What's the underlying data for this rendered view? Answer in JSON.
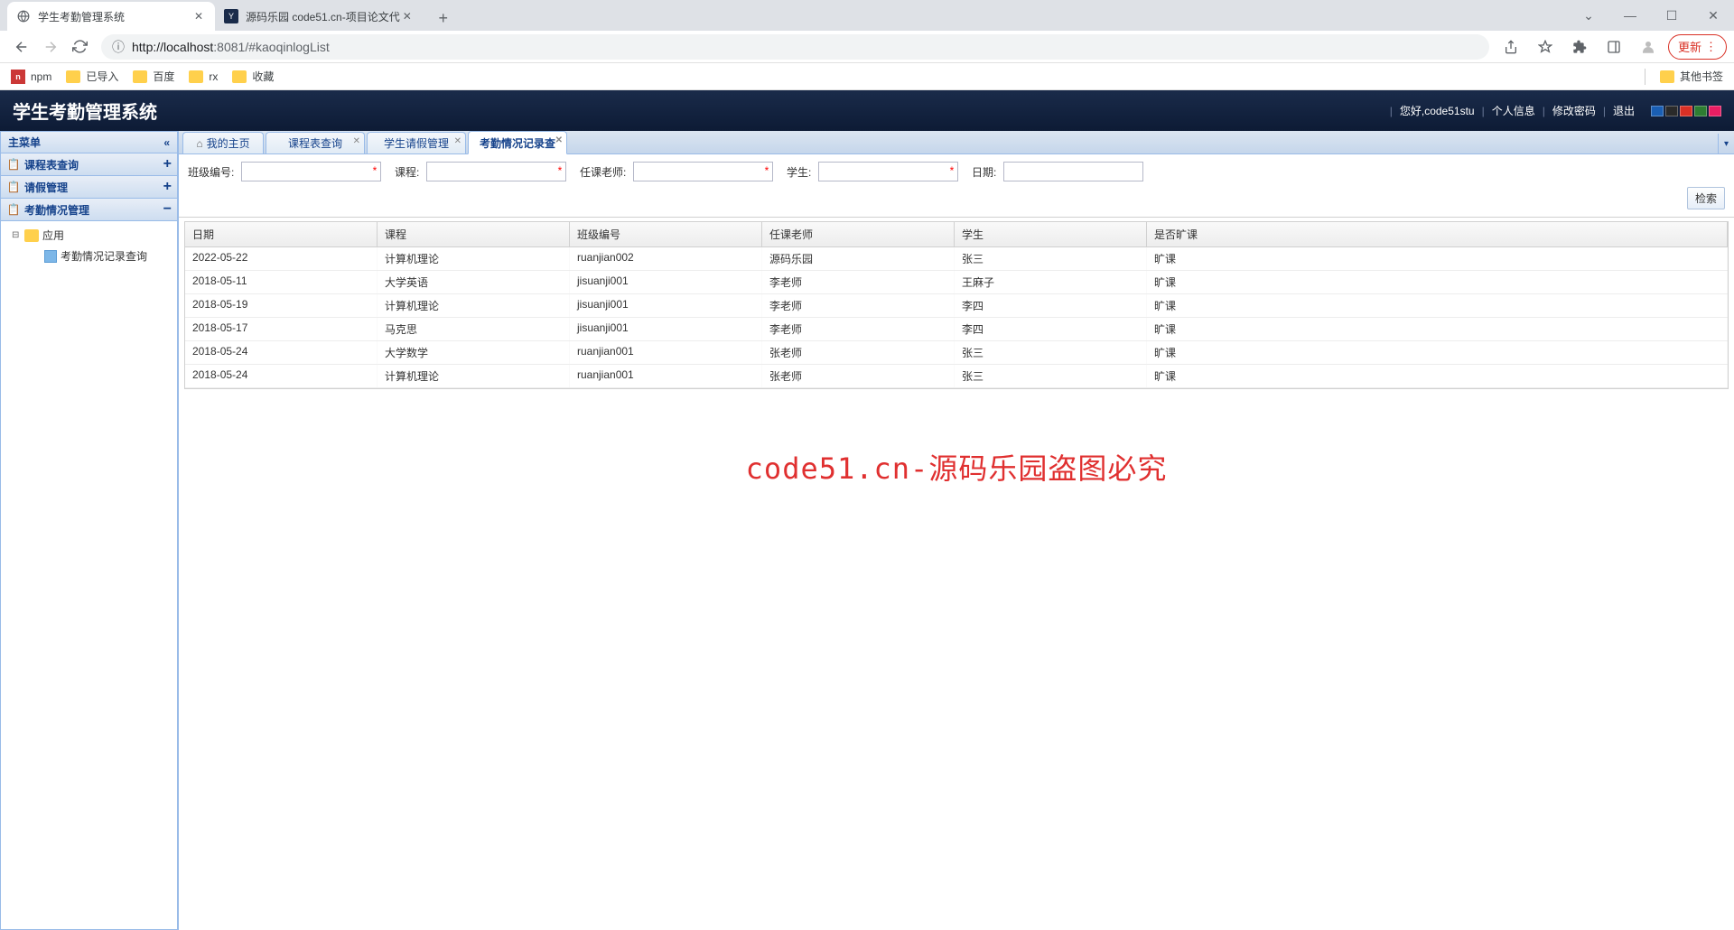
{
  "browser": {
    "tabs": [
      {
        "title": "学生考勤管理系统",
        "active": true
      },
      {
        "title": "源码乐园 code51.cn-项目论文代",
        "active": false
      }
    ],
    "url_info_icon": "ⓘ",
    "url_host": "http://localhost",
    "url_port": ":8081",
    "url_path": "/#kaoqinlogList",
    "update_label": "更新",
    "bookmarks": [
      "npm",
      "已导入",
      "百度",
      "rx",
      "收藏"
    ],
    "other_bookmarks": "其他书签"
  },
  "header": {
    "title": "学生考勤管理系统",
    "greeting": "您好,code51stu",
    "links": [
      "个人信息",
      "修改密码",
      "退出"
    ],
    "colors": [
      "#1a5fb4",
      "#2a2a2a",
      "#d93025",
      "#2e7d32",
      "#e91e63"
    ]
  },
  "sidebar": {
    "title": "主菜单",
    "panels": [
      {
        "label": "课程表查询",
        "expanded": false
      },
      {
        "label": "请假管理",
        "expanded": false
      },
      {
        "label": "考勤情况管理",
        "expanded": true
      }
    ],
    "tree_root": "应用",
    "tree_leaf": "考勤情况记录查询"
  },
  "tabs": [
    {
      "label": "我的主页",
      "home": true,
      "closable": false
    },
    {
      "label": "课程表查询",
      "closable": true
    },
    {
      "label": "学生请假管理",
      "closable": true
    },
    {
      "label": "考勤情况记录查",
      "closable": true,
      "active": true
    }
  ],
  "search": {
    "class_label": "班级编号:",
    "course_label": "课程:",
    "teacher_label": "任课老师:",
    "student_label": "学生:",
    "date_label": "日期:",
    "button": "检索"
  },
  "grid": {
    "headers": {
      "date": "日期",
      "course": "课程",
      "class": "班级编号",
      "teacher": "任课老师",
      "student": "学生",
      "absent": "是否旷课"
    },
    "rows": [
      {
        "date": "2022-05-22",
        "course": "计算机理论",
        "class": "ruanjian002",
        "teacher": "源码乐园",
        "student": "张三",
        "absent": "旷课"
      },
      {
        "date": "2018-05-11",
        "course": "大学英语",
        "class": "jisuanji001",
        "teacher": "李老师",
        "student": "王麻子",
        "absent": "旷课"
      },
      {
        "date": "2018-05-19",
        "course": "计算机理论",
        "class": "jisuanji001",
        "teacher": "李老师",
        "student": "李四",
        "absent": "旷课"
      },
      {
        "date": "2018-05-17",
        "course": "马克思",
        "class": "jisuanji001",
        "teacher": "李老师",
        "student": "李四",
        "absent": "旷课"
      },
      {
        "date": "2018-05-24",
        "course": "大学数学",
        "class": "ruanjian001",
        "teacher": "张老师",
        "student": "张三",
        "absent": "旷课"
      },
      {
        "date": "2018-05-24",
        "course": "计算机理论",
        "class": "ruanjian001",
        "teacher": "张老师",
        "student": "张三",
        "absent": "旷课"
      }
    ]
  },
  "watermark": "code51.cn-源码乐园盗图必究"
}
